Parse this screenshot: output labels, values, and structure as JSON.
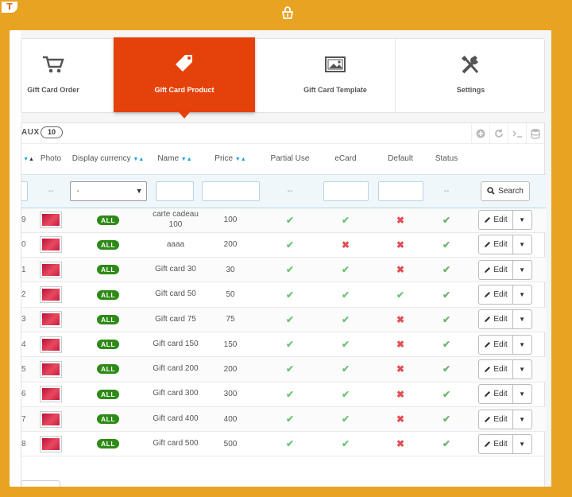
{
  "tabs": [
    {
      "label": "Gift Card Order",
      "icon": "cart-icon"
    },
    {
      "label": "Gift Card Product",
      "icon": "tag-icon",
      "active": true
    },
    {
      "label": "Gift Card Template",
      "icon": "image-icon"
    },
    {
      "label": "Settings",
      "icon": "tools-icon"
    }
  ],
  "list": {
    "title": "AUX",
    "count": "10"
  },
  "columns": [
    "",
    "Photo",
    "Display currency",
    "Name",
    "Price",
    "Partial Use",
    "eCard",
    "Default",
    "Status",
    ""
  ],
  "filter": {
    "photo_placeholder": "--",
    "currency_select": "-",
    "partial_placeholder": "--",
    "status_placeholder": "--",
    "search_label": "Search"
  },
  "rows": [
    {
      "id": "9",
      "currency": "ALL",
      "name": "carte cadeau 100",
      "price": "100",
      "partial": true,
      "ecard": true,
      "default": false,
      "status": true
    },
    {
      "id": "0",
      "currency": "ALL",
      "name": "aaaa",
      "price": "200",
      "partial": true,
      "ecard": false,
      "default": false,
      "status": true
    },
    {
      "id": "1",
      "currency": "ALL",
      "name": "Gift card 30",
      "price": "30",
      "partial": true,
      "ecard": true,
      "default": false,
      "status": true
    },
    {
      "id": "2",
      "currency": "ALL",
      "name": "Gift card 50",
      "price": "50",
      "partial": true,
      "ecard": true,
      "default": true,
      "status": true
    },
    {
      "id": "3",
      "currency": "ALL",
      "name": "Gift card 75",
      "price": "75",
      "partial": true,
      "ecard": true,
      "default": false,
      "status": true
    },
    {
      "id": "4",
      "currency": "ALL",
      "name": "Gift card 150",
      "price": "150",
      "partial": true,
      "ecard": true,
      "default": false,
      "status": true
    },
    {
      "id": "5",
      "currency": "ALL",
      "name": "Gift card 200",
      "price": "200",
      "partial": true,
      "ecard": true,
      "default": false,
      "status": true
    },
    {
      "id": "6",
      "currency": "ALL",
      "name": "Gift card 300",
      "price": "300",
      "partial": true,
      "ecard": true,
      "default": false,
      "status": true
    },
    {
      "id": "7",
      "currency": "ALL",
      "name": "Gift card 400",
      "price": "400",
      "partial": true,
      "ecard": true,
      "default": false,
      "status": true
    },
    {
      "id": "8",
      "currency": "ALL",
      "name": "Gift card 500",
      "price": "500",
      "partial": true,
      "ecard": true,
      "default": false,
      "status": true
    }
  ],
  "edit_label": "Edit",
  "colors": {
    "frame": "#e9a323",
    "active_tab": "#e5410a",
    "check": "#72c279",
    "cross": "#e14f53",
    "badge": "#2e8a16"
  }
}
